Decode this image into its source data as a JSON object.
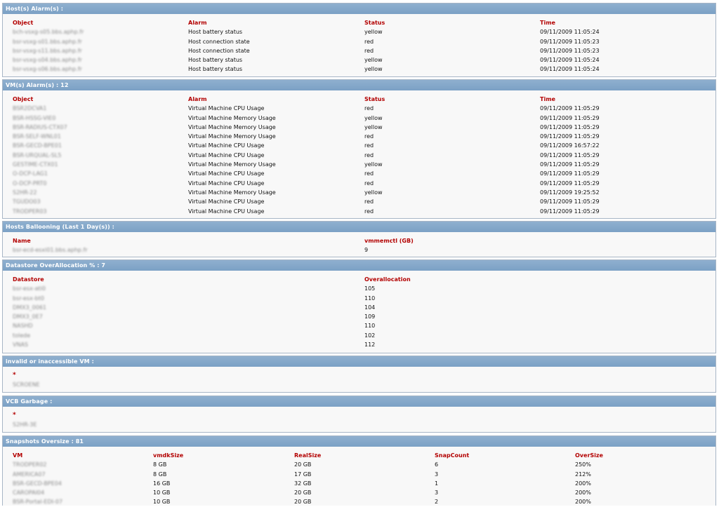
{
  "host_alarms": {
    "title": "Host(s) Alarm(s) :",
    "columns": [
      "Object",
      "Alarm",
      "Status",
      "Time"
    ],
    "rows": [
      [
        "bch-vsxg-s05.bbs.aphp.fr",
        "Host battery status",
        "yellow",
        "09/11/2009 11:05:24"
      ],
      [
        "bsr-vsxg-s01.bbs.aphp.fr",
        "Host connection state",
        "red",
        "09/11/2009 11:05:23"
      ],
      [
        "bsr-vsxg-s11.bbs.aphp.fr",
        "Host connection state",
        "red",
        "09/11/2009 11:05:23"
      ],
      [
        "bsr-vsxg-s04.bbs.aphp.fr",
        "Host battery status",
        "yellow",
        "09/11/2009 11:05:24"
      ],
      [
        "bsr-vsxg-s06.bbs.aphp.fr",
        "Host battery status",
        "yellow",
        "09/11/2009 11:05:24"
      ]
    ]
  },
  "vm_alarms": {
    "title": "VM(s) Alarm(s) : 12",
    "columns": [
      "Object",
      "Alarm",
      "Status",
      "Time"
    ],
    "rows": [
      [
        "BSR2DCVA1",
        "Virtual Machine CPU Usage",
        "red",
        "09/11/2009 11:05:29"
      ],
      [
        "BSR-HSSG-VIE0",
        "Virtual Machine Memory Usage",
        "yellow",
        "09/11/2009 11:05:29"
      ],
      [
        "BSR-RADIUS-CTX07",
        "Virtual Machine Memory Usage",
        "yellow",
        "09/11/2009 11:05:29"
      ],
      [
        "BSR-SELF-WNL01",
        "Virtual Machine Memory Usage",
        "red",
        "09/11/2009 11:05:29"
      ],
      [
        "BSR-GECD-BPE01",
        "Virtual Machine CPU Usage",
        "red",
        "09/11/2009 16:57:22"
      ],
      [
        "BSR-URQUAL-SL5",
        "Virtual Machine CPU Usage",
        "red",
        "09/11/2009 11:05:29"
      ],
      [
        "GESTIME-CTX01",
        "Virtual Machine Memory Usage",
        "yellow",
        "09/11/2009 11:05:29"
      ],
      [
        "O-DCP-LAG1",
        "Virtual Machine CPU Usage",
        "red",
        "09/11/2009 11:05:29"
      ],
      [
        "O-DCP-PRT0",
        "Virtual Machine CPU Usage",
        "red",
        "09/11/2009 11:05:29"
      ],
      [
        "S2HR-22",
        "Virtual Machine Memory Usage",
        "yellow",
        "09/11/2009 19:25:52"
      ],
      [
        "TGUDO03",
        "Virtual Machine CPU Usage",
        "red",
        "09/11/2009 11:05:29"
      ],
      [
        "TRODPER03",
        "Virtual Machine CPU Usage",
        "red",
        "09/11/2009 11:05:29"
      ]
    ]
  },
  "ballooning": {
    "title": "Hosts Ballooning (Last 1 Day(s)) :",
    "columns": [
      "Name",
      "vmmemctl (GB)"
    ],
    "rows": [
      [
        "bsr-ecd-esxi01.bbs.aphp.fr",
        "9"
      ]
    ]
  },
  "datastore": {
    "title": "Datastore OverAllocation % : 7",
    "columns": [
      "Datastore",
      "Overallocation"
    ],
    "rows": [
      [
        "bsr-esx-ati0",
        "105"
      ],
      [
        "bsr-esx-bt0",
        "110"
      ],
      [
        "DMX3_0061",
        "104"
      ],
      [
        "DMX3_0E7",
        "109"
      ],
      [
        "NASHD",
        "110"
      ],
      [
        "tolede",
        "102"
      ],
      [
        "VNAS",
        "112"
      ]
    ]
  },
  "invalid_vm": {
    "title": "invalid or inaccessible VM :",
    "marker": "*",
    "items": [
      "SCROENE"
    ]
  },
  "vcb_garbage": {
    "title": "VCB Garbage :",
    "marker": "*",
    "items": [
      "S2HR-3E"
    ]
  },
  "snapshots": {
    "title": "Snapshots Oversize : 81",
    "columns": [
      "VM",
      "vmdkSize",
      "RealSize",
      "SnapCount",
      "OverSize"
    ],
    "rows": [
      [
        "TRODPER02",
        "8 GB",
        "20 GB",
        "6",
        "250%"
      ],
      [
        "AMERICA07",
        "8 GB",
        "17 GB",
        "3",
        "212%"
      ],
      [
        "BSR-GECD-BPE04",
        "16 GB",
        "32 GB",
        "1",
        "200%"
      ],
      [
        "CAROPAI04",
        "10 GB",
        "20 GB",
        "3",
        "200%"
      ],
      [
        "BSR-Portal-EDI-07",
        "10 GB",
        "20 GB",
        "2",
        "200%"
      ]
    ]
  }
}
